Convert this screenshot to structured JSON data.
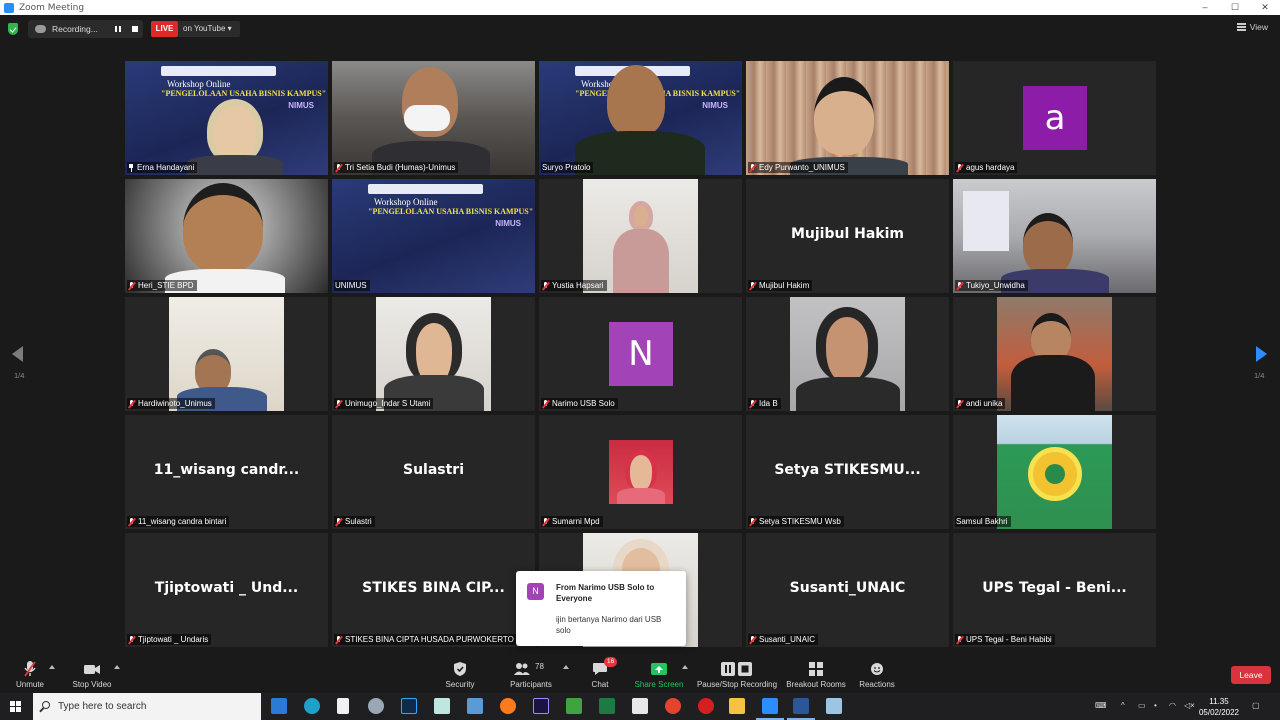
{
  "window": {
    "title": "Zoom Meeting",
    "controls": [
      "–",
      "☐",
      "✕"
    ]
  },
  "topbar": {
    "recording_label": "Recording...",
    "live_label": "LIVE",
    "youtube_label": "on YouTube ▾",
    "view_label": "View"
  },
  "participants": [
    {
      "name": "Erna Handayani",
      "display": "",
      "status": "pinned"
    },
    {
      "name": "Tri Setia Budi (Humas)-Unimus",
      "display": "",
      "status": "muted"
    },
    {
      "name": "Suryo Pratolo",
      "display": "",
      "status": "speaking"
    },
    {
      "name": "Edy Purwanto_UNIMUS",
      "display": "",
      "status": "muted"
    },
    {
      "name": "agus hardaya",
      "display": "a",
      "status": "muted"
    },
    {
      "name": "Heri_STIE BPD",
      "display": "",
      "status": "muted"
    },
    {
      "name": "UNIMUS",
      "display": "",
      "status": "none"
    },
    {
      "name": "Yustia Hapsari",
      "display": "",
      "status": "muted"
    },
    {
      "name": "Mujibul Hakim",
      "display": "Mujibul Hakim",
      "status": "muted"
    },
    {
      "name": "Tukiyo_Unwidha",
      "display": "",
      "status": "muted"
    },
    {
      "name": "Hardiwinoto_Unimus",
      "display": "",
      "status": "muted"
    },
    {
      "name": "Unimugo_Indar S Utami",
      "display": "",
      "status": "muted"
    },
    {
      "name": "Narimo USB Solo",
      "display": "N",
      "status": "muted"
    },
    {
      "name": "Ida B",
      "display": "",
      "status": "muted"
    },
    {
      "name": "andi unika",
      "display": "",
      "status": "muted"
    },
    {
      "name": "11_wisang candra bintari",
      "display": "11_wisang candr...",
      "status": "muted"
    },
    {
      "name": "Sulastri",
      "display": "Sulastri",
      "status": "muted"
    },
    {
      "name": "Sumarni Mpd",
      "display": "",
      "status": "muted"
    },
    {
      "name": "Setya STIKESMU Wsb",
      "display": "Setya STIKESMU...",
      "status": "muted"
    },
    {
      "name": "Samsul Bakhri",
      "display": "",
      "status": "none"
    },
    {
      "name": "Tjiptowati _ Undaris",
      "display": "Tjiptowati _ Und...",
      "status": "muted"
    },
    {
      "name": "STIKES BINA CIPTA HUSADA PURWOKERTO",
      "display": "STIKES BINA CIP...",
      "status": "muted"
    },
    {
      "name": "",
      "display": "",
      "status": "none"
    },
    {
      "name": "Susanti_UNAIC",
      "display": "Susanti_UNAIC",
      "status": "muted"
    },
    {
      "name": "UPS Tegal - Beni Habibi",
      "display": "UPS Tegal - Beni...",
      "status": "muted"
    }
  ],
  "workshop_banner": {
    "line1": "Workshop Online",
    "line2": "\"PENGELOLAAN USAHA BISNIS KAMPUS\"",
    "brand": "NIMUS"
  },
  "pagination": {
    "left": "1/4",
    "right": "1/4"
  },
  "chat_popup": {
    "avatar": "N",
    "from": "From Narimo USB Solo to Everyone",
    "message": "ijin bertanya Narimo dari USB solo"
  },
  "toolbar": {
    "unmute": "Unmute",
    "stop_video": "Stop Video",
    "security": "Security",
    "participants": "Participants",
    "participants_count": "78",
    "chat": "Chat",
    "chat_badge": "16",
    "share_screen": "Share Screen",
    "pause_recording": "Pause/Stop Recording",
    "breakout_rooms": "Breakout Rooms",
    "reactions": "Reactions",
    "leave": "Leave"
  },
  "taskbar": {
    "search_placeholder": "Type here to search",
    "time": "11.35",
    "date": "05/02/2022"
  },
  "colors": {
    "accent_blue": "#2d8cff",
    "live_red": "#e02828",
    "leave_red": "#d9333c",
    "share_green": "#23c55e",
    "active_speaker": "#e3e04a",
    "avatar_purple": "#8d1ca8"
  }
}
